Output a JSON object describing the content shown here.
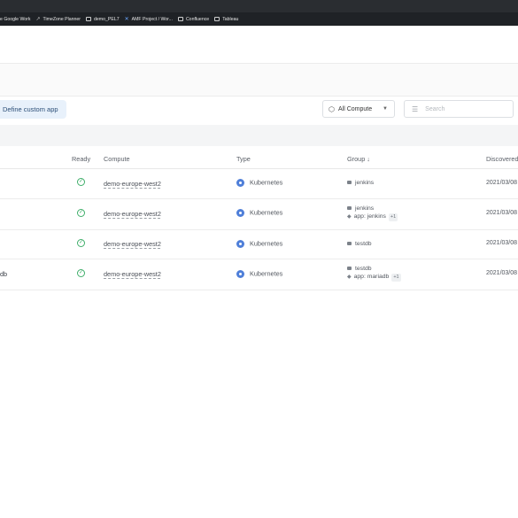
{
  "browser": {
    "bookmarks": [
      {
        "label": "e Google Work",
        "icon": "bookmark-icon"
      },
      {
        "label": "TimeZone Planner",
        "icon": "arrow-icon"
      },
      {
        "label": "demo_PEL7",
        "icon": "folder-icon"
      },
      {
        "label": "AMF Project / Wor...",
        "icon": "x-icon"
      },
      {
        "label": "Confluence",
        "icon": "folder-icon"
      },
      {
        "label": "Tableau",
        "icon": "folder-icon"
      }
    ]
  },
  "toolbar": {
    "define_label": "Define custom app",
    "compute_filter": "All Compute",
    "search_placeholder": "Search"
  },
  "table": {
    "headers": {
      "ready": "Ready",
      "compute": "Compute",
      "type": "Type",
      "group": "Group ↓",
      "discovered": "Discovered"
    },
    "rows": [
      {
        "name": "",
        "compute": "demo-europe-west2",
        "type": "Kubernetes",
        "group_primary": "jenkins",
        "tag": "",
        "tag_more": "",
        "discovered": "2021/03/08"
      },
      {
        "name": "",
        "compute": "demo-europe-west2",
        "type": "Kubernetes",
        "group_primary": "jenkins",
        "tag": "app: jenkins",
        "tag_more": "+1",
        "discovered": "2021/03/08"
      },
      {
        "name": "",
        "compute": "demo-europe-west2",
        "type": "Kubernetes",
        "group_primary": "testdb",
        "tag": "",
        "tag_more": "",
        "discovered": "2021/03/08"
      },
      {
        "name": "db",
        "compute": "demo-europe-west2",
        "type": "Kubernetes",
        "group_primary": "testdb",
        "tag": "app: mariadb",
        "tag_more": "+1",
        "discovered": "2021/03/08"
      }
    ]
  },
  "colors": {
    "ready_green": "#3fae6a",
    "kubernetes_blue": "#4f7fd9",
    "define_button_bg": "#e8f1fb"
  }
}
